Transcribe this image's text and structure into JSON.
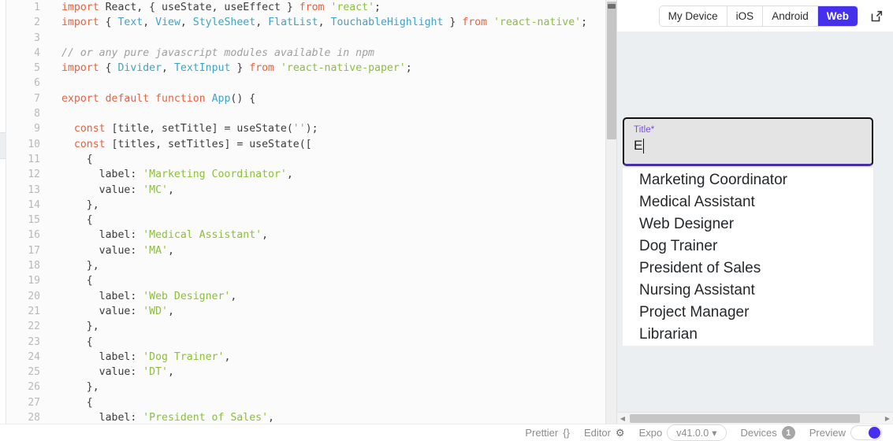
{
  "editor": {
    "name": "code-editor",
    "lines": [
      {
        "num": "1",
        "tokens": [
          {
            "t": "import",
            "c": "kw"
          },
          {
            "t": " React, { useState, useEffect } ",
            "c": "pl"
          },
          {
            "t": "from",
            "c": "kw"
          },
          {
            "t": " ",
            "c": "pl"
          },
          {
            "t": "'react'",
            "c": "str"
          },
          {
            "t": ";",
            "c": "pl"
          }
        ]
      },
      {
        "num": "2",
        "tokens": [
          {
            "t": "import",
            "c": "kw"
          },
          {
            "t": " { ",
            "c": "pl"
          },
          {
            "t": "Text",
            "c": "cls"
          },
          {
            "t": ", ",
            "c": "pl"
          },
          {
            "t": "View",
            "c": "cls"
          },
          {
            "t": ", ",
            "c": "pl"
          },
          {
            "t": "StyleSheet",
            "c": "cls"
          },
          {
            "t": ", ",
            "c": "pl"
          },
          {
            "t": "FlatList",
            "c": "cls"
          },
          {
            "t": ", ",
            "c": "pl"
          },
          {
            "t": "TouchableHighlight",
            "c": "cls"
          },
          {
            "t": " } ",
            "c": "pl"
          },
          {
            "t": "from",
            "c": "kw"
          },
          {
            "t": " ",
            "c": "pl"
          },
          {
            "t": "'react-native'",
            "c": "str"
          },
          {
            "t": ";",
            "c": "pl"
          }
        ]
      },
      {
        "num": "3",
        "tokens": []
      },
      {
        "num": "4",
        "tokens": [
          {
            "t": "// or any pure javascript modules available in npm",
            "c": "cmt"
          }
        ]
      },
      {
        "num": "5",
        "tokens": [
          {
            "t": "import",
            "c": "kw"
          },
          {
            "t": " { ",
            "c": "pl"
          },
          {
            "t": "Divider",
            "c": "cls"
          },
          {
            "t": ", ",
            "c": "pl"
          },
          {
            "t": "TextInput",
            "c": "cls"
          },
          {
            "t": " } ",
            "c": "pl"
          },
          {
            "t": "from",
            "c": "kw"
          },
          {
            "t": " ",
            "c": "pl"
          },
          {
            "t": "'react-native-paper'",
            "c": "str"
          },
          {
            "t": ";",
            "c": "pl"
          }
        ]
      },
      {
        "num": "6",
        "tokens": []
      },
      {
        "num": "7",
        "tokens": [
          {
            "t": "export default",
            "c": "kw"
          },
          {
            "t": " ",
            "c": "pl"
          },
          {
            "t": "function",
            "c": "kw"
          },
          {
            "t": " ",
            "c": "pl"
          },
          {
            "t": "App",
            "c": "cls"
          },
          {
            "t": "() {",
            "c": "pl"
          }
        ]
      },
      {
        "num": "8",
        "tokens": []
      },
      {
        "num": "9",
        "tokens": [
          {
            "t": "  ",
            "c": "pl"
          },
          {
            "t": "const",
            "c": "kw"
          },
          {
            "t": " [title, setTitle] = useState(",
            "c": "pl"
          },
          {
            "t": "''",
            "c": "str"
          },
          {
            "t": ");",
            "c": "pl"
          }
        ]
      },
      {
        "num": "10",
        "tokens": [
          {
            "t": "  ",
            "c": "pl"
          },
          {
            "t": "const",
            "c": "kw"
          },
          {
            "t": " [titles, setTitles] = useState([",
            "c": "pl"
          }
        ]
      },
      {
        "num": "11",
        "tokens": [
          {
            "t": "    {",
            "c": "pl"
          }
        ]
      },
      {
        "num": "12",
        "tokens": [
          {
            "t": "      label: ",
            "c": "pl"
          },
          {
            "t": "'Marketing Coordinator'",
            "c": "str"
          },
          {
            "t": ",",
            "c": "pl"
          }
        ]
      },
      {
        "num": "13",
        "tokens": [
          {
            "t": "      value: ",
            "c": "pl"
          },
          {
            "t": "'MC'",
            "c": "str"
          },
          {
            "t": ",",
            "c": "pl"
          }
        ]
      },
      {
        "num": "14",
        "tokens": [
          {
            "t": "    },",
            "c": "pl"
          }
        ]
      },
      {
        "num": "15",
        "tokens": [
          {
            "t": "    {",
            "c": "pl"
          }
        ]
      },
      {
        "num": "16",
        "tokens": [
          {
            "t": "      label: ",
            "c": "pl"
          },
          {
            "t": "'Medical Assistant'",
            "c": "str"
          },
          {
            "t": ",",
            "c": "pl"
          }
        ]
      },
      {
        "num": "17",
        "tokens": [
          {
            "t": "      value: ",
            "c": "pl"
          },
          {
            "t": "'MA'",
            "c": "str"
          },
          {
            "t": ",",
            "c": "pl"
          }
        ]
      },
      {
        "num": "18",
        "tokens": [
          {
            "t": "    },",
            "c": "pl"
          }
        ]
      },
      {
        "num": "19",
        "tokens": [
          {
            "t": "    {",
            "c": "pl"
          }
        ]
      },
      {
        "num": "20",
        "tokens": [
          {
            "t": "      label: ",
            "c": "pl"
          },
          {
            "t": "'Web Designer'",
            "c": "str"
          },
          {
            "t": ",",
            "c": "pl"
          }
        ]
      },
      {
        "num": "21",
        "tokens": [
          {
            "t": "      value: ",
            "c": "pl"
          },
          {
            "t": "'WD'",
            "c": "str"
          },
          {
            "t": ",",
            "c": "pl"
          }
        ]
      },
      {
        "num": "22",
        "tokens": [
          {
            "t": "    },",
            "c": "pl"
          }
        ]
      },
      {
        "num": "23",
        "tokens": [
          {
            "t": "    {",
            "c": "pl"
          }
        ]
      },
      {
        "num": "24",
        "tokens": [
          {
            "t": "      label: ",
            "c": "pl"
          },
          {
            "t": "'Dog Trainer'",
            "c": "str"
          },
          {
            "t": ",",
            "c": "pl"
          }
        ]
      },
      {
        "num": "25",
        "tokens": [
          {
            "t": "      value: ",
            "c": "pl"
          },
          {
            "t": "'DT'",
            "c": "str"
          },
          {
            "t": ",",
            "c": "pl"
          }
        ]
      },
      {
        "num": "26",
        "tokens": [
          {
            "t": "    },",
            "c": "pl"
          }
        ]
      },
      {
        "num": "27",
        "tokens": [
          {
            "t": "    {",
            "c": "pl"
          }
        ]
      },
      {
        "num": "28",
        "tokens": [
          {
            "t": "      label: ",
            "c": "pl"
          },
          {
            "t": "'President of Sales'",
            "c": "str"
          },
          {
            "t": ",",
            "c": "pl"
          }
        ]
      }
    ]
  },
  "preview": {
    "platform_tabs": [
      {
        "label": "My Device",
        "active": false
      },
      {
        "label": "iOS",
        "active": false
      },
      {
        "label": "Android",
        "active": false
      },
      {
        "label": "Web",
        "active": true
      }
    ],
    "open_external_title": "Open in new tab",
    "text_input": {
      "label": "Title*",
      "value": "E"
    },
    "suggestions": [
      "Marketing Coordinator",
      "Medical Assistant",
      "Web Designer",
      "Dog Trainer",
      "President of Sales",
      "Nursing Assistant",
      "Project Manager",
      "Librarian"
    ]
  },
  "statusbar": {
    "prettier_label": "Prettier",
    "prettier_icon": "{}",
    "editor_label": "Editor",
    "expo_label": "Expo",
    "expo_version": "v41.0.0",
    "expo_caret": "▾",
    "devices_label": "Devices",
    "devices_count": "1",
    "preview_label": "Preview"
  },
  "colors": {
    "accent": "#4630eb",
    "input_label": "#7a4fd6",
    "panel_bg": "#eceff1"
  }
}
